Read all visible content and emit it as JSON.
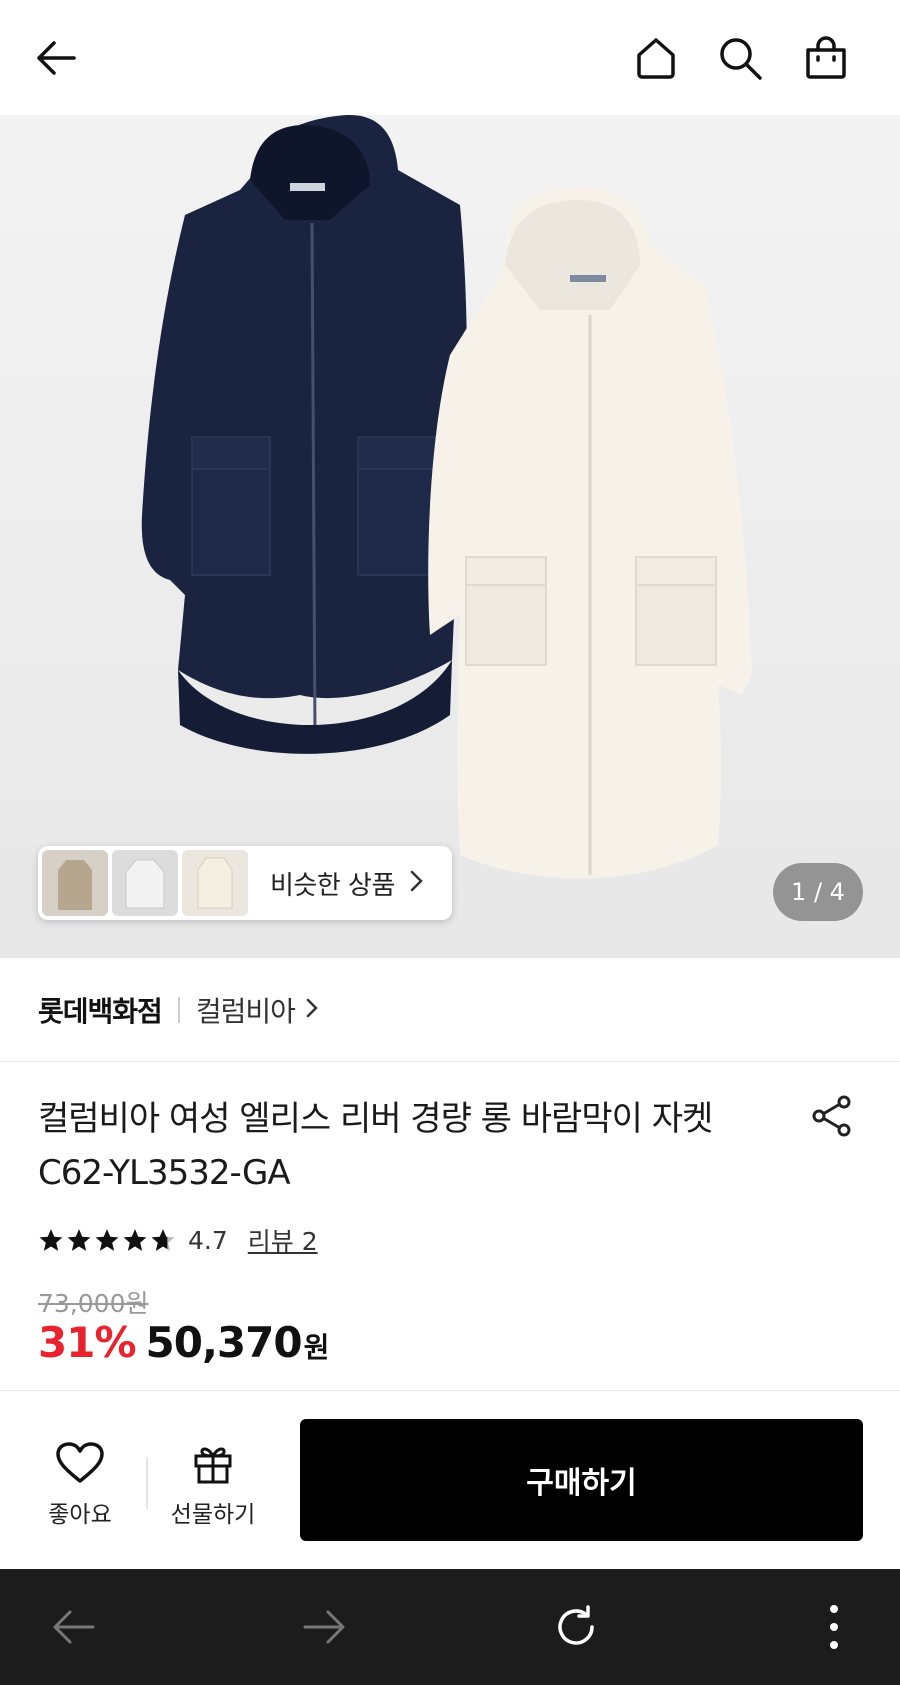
{
  "header": {
    "icons": [
      "back-arrow-icon",
      "home-icon",
      "search-icon",
      "shopping-bag-icon"
    ]
  },
  "gallery": {
    "similar_label": "비슷한 상품",
    "pager": "1 / 4"
  },
  "brand": {
    "store": "롯데백화점",
    "name": "컬럼비아"
  },
  "product": {
    "title": "컬럼비아 여성 엘리스 리버 경량 롱 바람막이 자켓 C62-YL3532-GA",
    "rating": "4.7",
    "review_link": "리뷰 2",
    "original_price": "73,000원",
    "discount": "31%",
    "price": "50,370",
    "currency": "원"
  },
  "actions": {
    "like_label": "좋아요",
    "gift_label": "선물하기",
    "buy_label": "구매하기"
  },
  "colors": {
    "discount_red": "#e8232e",
    "buy_button": "#000000",
    "browser_bar": "#1c1c1c"
  },
  "browser": {
    "icons": [
      "back-arrow-icon",
      "forward-arrow-icon",
      "reload-icon",
      "more-vertical-icon"
    ]
  }
}
